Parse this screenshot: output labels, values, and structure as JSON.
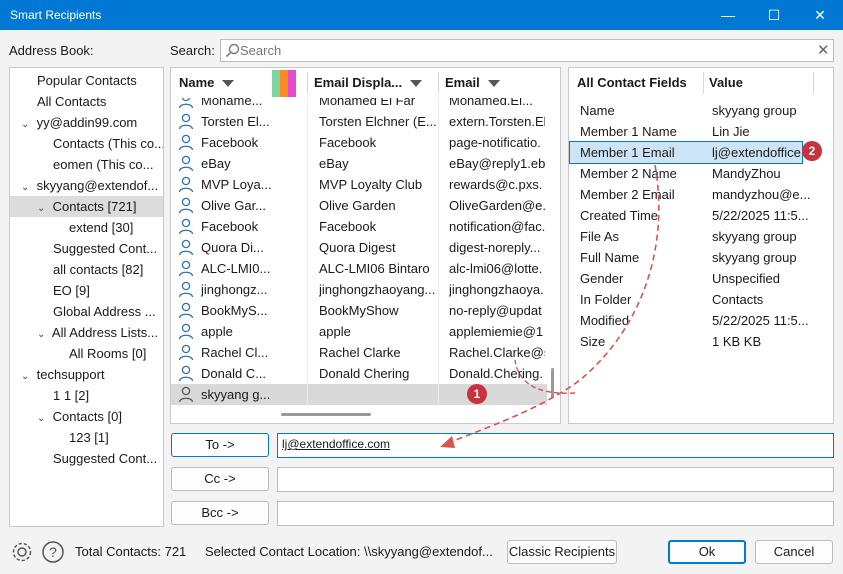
{
  "window": {
    "title": "Smart Recipients"
  },
  "address_book": {
    "label": "Address Book:",
    "items": [
      {
        "label": "Popular Contacts"
      },
      {
        "label": "All Contacts"
      },
      {
        "label": "yy@addin99.com"
      },
      {
        "label": "Contacts (This co..."
      },
      {
        "label": "eomen (This co..."
      },
      {
        "label": "skyyang@extendof..."
      },
      {
        "label": "Contacts [721]"
      },
      {
        "label": "extend [30]"
      },
      {
        "label": "Suggested Cont..."
      },
      {
        "label": "all contacts [82]"
      },
      {
        "label": "EO [9]"
      },
      {
        "label": "Global Address ..."
      },
      {
        "label": "All Address Lists..."
      },
      {
        "label": "All Rooms [0]"
      },
      {
        "label": "techsupport"
      },
      {
        "label": "1 1 [2]"
      },
      {
        "label": "Contacts [0]"
      },
      {
        "label": "123 [1]"
      },
      {
        "label": "Suggested Cont..."
      }
    ]
  },
  "search": {
    "label": "Search:",
    "placeholder": "Search"
  },
  "contacts": {
    "columns": {
      "name": "Name",
      "display": "Email Displa...",
      "email": "Email"
    },
    "rows": [
      {
        "name": "Mohame...",
        "display": "Mohamed El Far",
        "email": "Mohamed.El..."
      },
      {
        "name": "Torsten El...",
        "display": "Torsten Elchner (E...",
        "email": "extern.Torsten.El"
      },
      {
        "name": "Facebook",
        "display": "Facebook",
        "email": "page-notificatio."
      },
      {
        "name": "eBay",
        "display": "eBay",
        "email": "eBay@reply1.eb"
      },
      {
        "name": "MVP Loya...",
        "display": "MVP Loyalty Club",
        "email": "rewards@c.pxs."
      },
      {
        "name": "Olive Gar...",
        "display": "Olive Garden",
        "email": "OliveGarden@e."
      },
      {
        "name": "Facebook",
        "display": "Facebook",
        "email": "notification@fac."
      },
      {
        "name": "Quora Di...",
        "display": "Quora Digest",
        "email": "digest-noreply..."
      },
      {
        "name": "ALC-LMI0...",
        "display": "ALC-LMI06 Bintaro",
        "email": "alc-lmi06@lotte."
      },
      {
        "name": "jinghongz...",
        "display": "jinghongzhaoyang...",
        "email": "jinghongzhaoya."
      },
      {
        "name": "BookMyS...",
        "display": "BookMyShow",
        "email": "no-reply@updat"
      },
      {
        "name": "apple",
        "display": "apple",
        "email": "applemiemie@1"
      },
      {
        "name": "Rachel Cl...",
        "display": "Rachel Clarke",
        "email": "Rachel.Clarke@s"
      },
      {
        "name": "Donald C...",
        "display": "Donald Chering",
        "email": "Donald.Chering."
      },
      {
        "name": "skyyang g...",
        "display": "",
        "email": ""
      }
    ]
  },
  "fields": {
    "columns": {
      "field": "All Contact Fields",
      "value": "Value"
    },
    "rows": [
      {
        "field": "Name",
        "value": "skyyang group"
      },
      {
        "field": "Member 1 Name",
        "value": "Lin Jie"
      },
      {
        "field": "Member 1 Email",
        "value": "lj@extendoffice...."
      },
      {
        "field": "Member 2 Name",
        "value": "MandyZhou"
      },
      {
        "field": "Member 2 Email",
        "value": "mandyzhou@e..."
      },
      {
        "field": "Created Time",
        "value": "5/22/2025 11:5..."
      },
      {
        "field": "File As",
        "value": "skyyang group"
      },
      {
        "field": "Full Name",
        "value": "skyyang group"
      },
      {
        "field": "Gender",
        "value": "Unspecified"
      },
      {
        "field": "In Folder",
        "value": "Contacts"
      },
      {
        "field": "Modified",
        "value": "5/22/2025 11:5..."
      },
      {
        "field": "Size",
        "value": "1 KB KB"
      }
    ]
  },
  "recipients": {
    "to_label": "To ->",
    "to_value": "lj@extendoffice.com",
    "cc_label": "Cc ->",
    "cc_value": "",
    "bcc_label": "Bcc ->",
    "bcc_value": ""
  },
  "annotations": {
    "badge1": "1",
    "badge2": "2"
  },
  "footer": {
    "total": "Total Contacts: 721",
    "location": "Selected Contact Location: \\\\skyyang@extendof...",
    "classic": "Classic Recipients",
    "ok": "Ok",
    "cancel": "Cancel"
  },
  "colors": {
    "accent": "#0078d4",
    "badge": "#c8323c",
    "arrow": "#d9534f"
  }
}
